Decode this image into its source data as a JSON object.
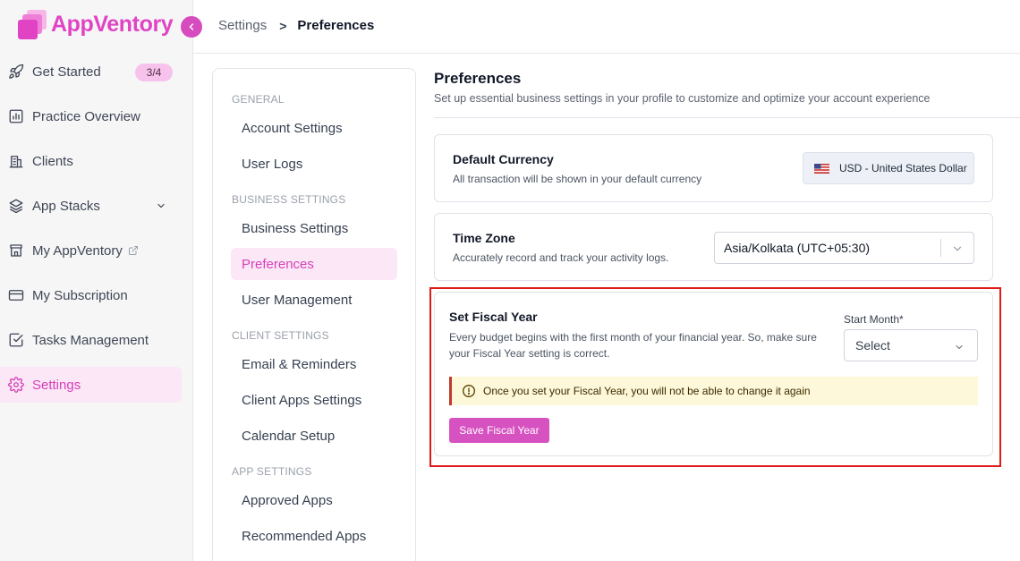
{
  "app": {
    "name": "AppVentory",
    "brand_color": "#e044c4",
    "accent_bg": "#fce7f6"
  },
  "sidebar": {
    "items": [
      {
        "label": "Get Started",
        "icon": "rocket-icon",
        "badge": "3/4"
      },
      {
        "label": "Practice Overview",
        "icon": "chart-icon"
      },
      {
        "label": "Clients",
        "icon": "building-icon"
      },
      {
        "label": "App Stacks",
        "icon": "layers-icon"
      },
      {
        "label": "My AppVentory",
        "icon": "store-icon"
      },
      {
        "label": "My Subscription",
        "icon": "card-icon"
      },
      {
        "label": "Tasks Management",
        "icon": "task-check-icon"
      },
      {
        "label": "Settings",
        "icon": "gear-icon"
      }
    ],
    "active": "Settings"
  },
  "breadcrumb": {
    "parent": "Settings",
    "current": "Preferences"
  },
  "settings_menu": {
    "sections": [
      {
        "heading": "GENERAL",
        "items": [
          "Account Settings",
          "User Logs"
        ]
      },
      {
        "heading": "BUSINESS SETTINGS",
        "items": [
          "Business Settings",
          "Preferences",
          "User Management"
        ]
      },
      {
        "heading": "CLIENT SETTINGS",
        "items": [
          "Email & Reminders",
          "Client Apps Settings",
          "Calendar Setup"
        ]
      },
      {
        "heading": "APP SETTINGS",
        "items": [
          "Approved Apps",
          "Recommended Apps"
        ]
      }
    ],
    "active": "Preferences"
  },
  "main": {
    "title": "Preferences",
    "subtitle": "Set up essential business settings in your profile to customize and optimize your account experience",
    "currency": {
      "title": "Default Currency",
      "description": "All transaction will be shown in your default currency",
      "value": "USD - United States Dollar"
    },
    "timezone": {
      "title": "Time Zone",
      "description": "Accurately record and track your activity logs.",
      "value": "Asia/Kolkata (UTC+05:30)"
    },
    "fiscal_year": {
      "title": "Set Fiscal Year",
      "description_line1": "Every budget begins with the first month of your financial year. So, make sure",
      "description_line2": "your Fiscal Year setting is correct.",
      "start_month_label": "Start Month*",
      "start_month_placeholder": "Select",
      "warning": "Once you set your Fiscal Year, you will not be able to change it again",
      "save_label": "Save Fiscal Year"
    }
  }
}
